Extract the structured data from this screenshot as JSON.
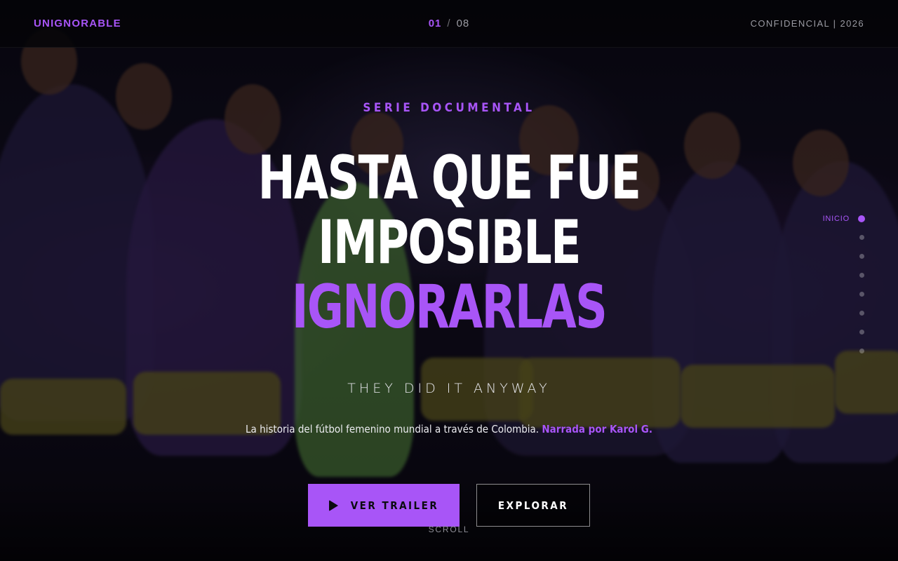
{
  "header": {
    "brand": "UNIGNORABLE",
    "pager": {
      "current": "01",
      "separator": "/",
      "total": "08"
    },
    "confidential": "CONFIDENCIAL | 2026"
  },
  "hero": {
    "eyebrow": "SERIE DOCUMENTAL",
    "title_line1": "HASTA QUE FUE",
    "title_line2": "IMPOSIBLE",
    "title_line3": "IGNORARLAS",
    "tagline": "THEY DID IT ANYWAY",
    "description": "La historia del fútbol femenino mundial a través de Colombia.",
    "narrated": "Narrada por Karol G.",
    "primary_button": "VER TRAILER",
    "secondary_button": "EXPLORAR",
    "scroll": "SCROLL"
  },
  "side_nav": {
    "active_label": "INICIO",
    "active_index": 0,
    "count": 8
  },
  "colors": {
    "accent": "#a855f7",
    "background": "#000000",
    "text": "#ffffff"
  },
  "icons": {
    "play": "play-icon"
  }
}
